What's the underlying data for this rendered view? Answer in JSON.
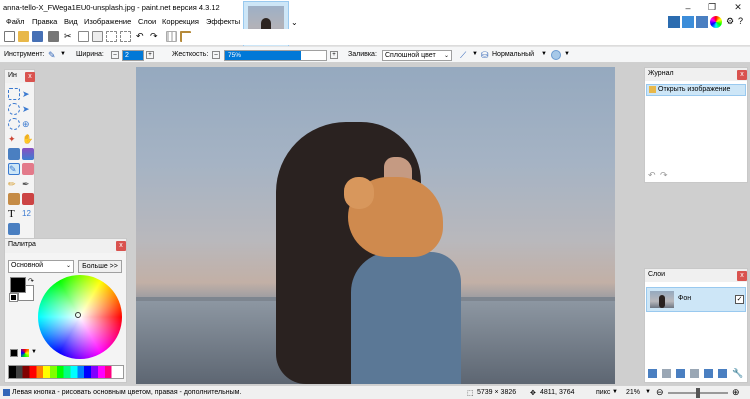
{
  "window": {
    "title": "anna-tello-X_FWega1EU0-unsplash.jpg - paint.net версия 4.3.12"
  },
  "menu": [
    "Файл",
    "Правка",
    "Вид",
    "Изображение",
    "Слои",
    "Коррекция",
    "Эффекты"
  ],
  "toolbar2": {
    "tool_label": "Инструмент:",
    "width_label": "Ширина:",
    "width_value": "2",
    "hardness_label": "Жесткость:",
    "hardness_value": "75%",
    "hardness_fraction": 0.75,
    "fill_label": "Заливка:",
    "fill_value": "Сплошной цвет",
    "blend_value": "Нормальный"
  },
  "tools_panel": {
    "title": "Ин"
  },
  "palette": {
    "title": "Палитра",
    "mode_value": "Основной",
    "more_label": "Больше >>",
    "primary_color": "#000000",
    "secondary_color": "#ffffff"
  },
  "history": {
    "title": "Журнал",
    "items": [
      {
        "label": "Открыть изображение"
      }
    ]
  },
  "layers": {
    "title": "Слои",
    "items": [
      {
        "label": "Фон",
        "visible": true
      }
    ]
  },
  "status": {
    "hint": "Левая кнопка - рисовать основным цветом, правая - дополнительным.",
    "image_size": "5739 × 3826",
    "cursor_pos": "4811, 3764",
    "unit": "пикс",
    "zoom": "21%"
  },
  "colors": {
    "accent": "#0078d7",
    "selection": "#cde6f7",
    "close": "#d9534f"
  }
}
